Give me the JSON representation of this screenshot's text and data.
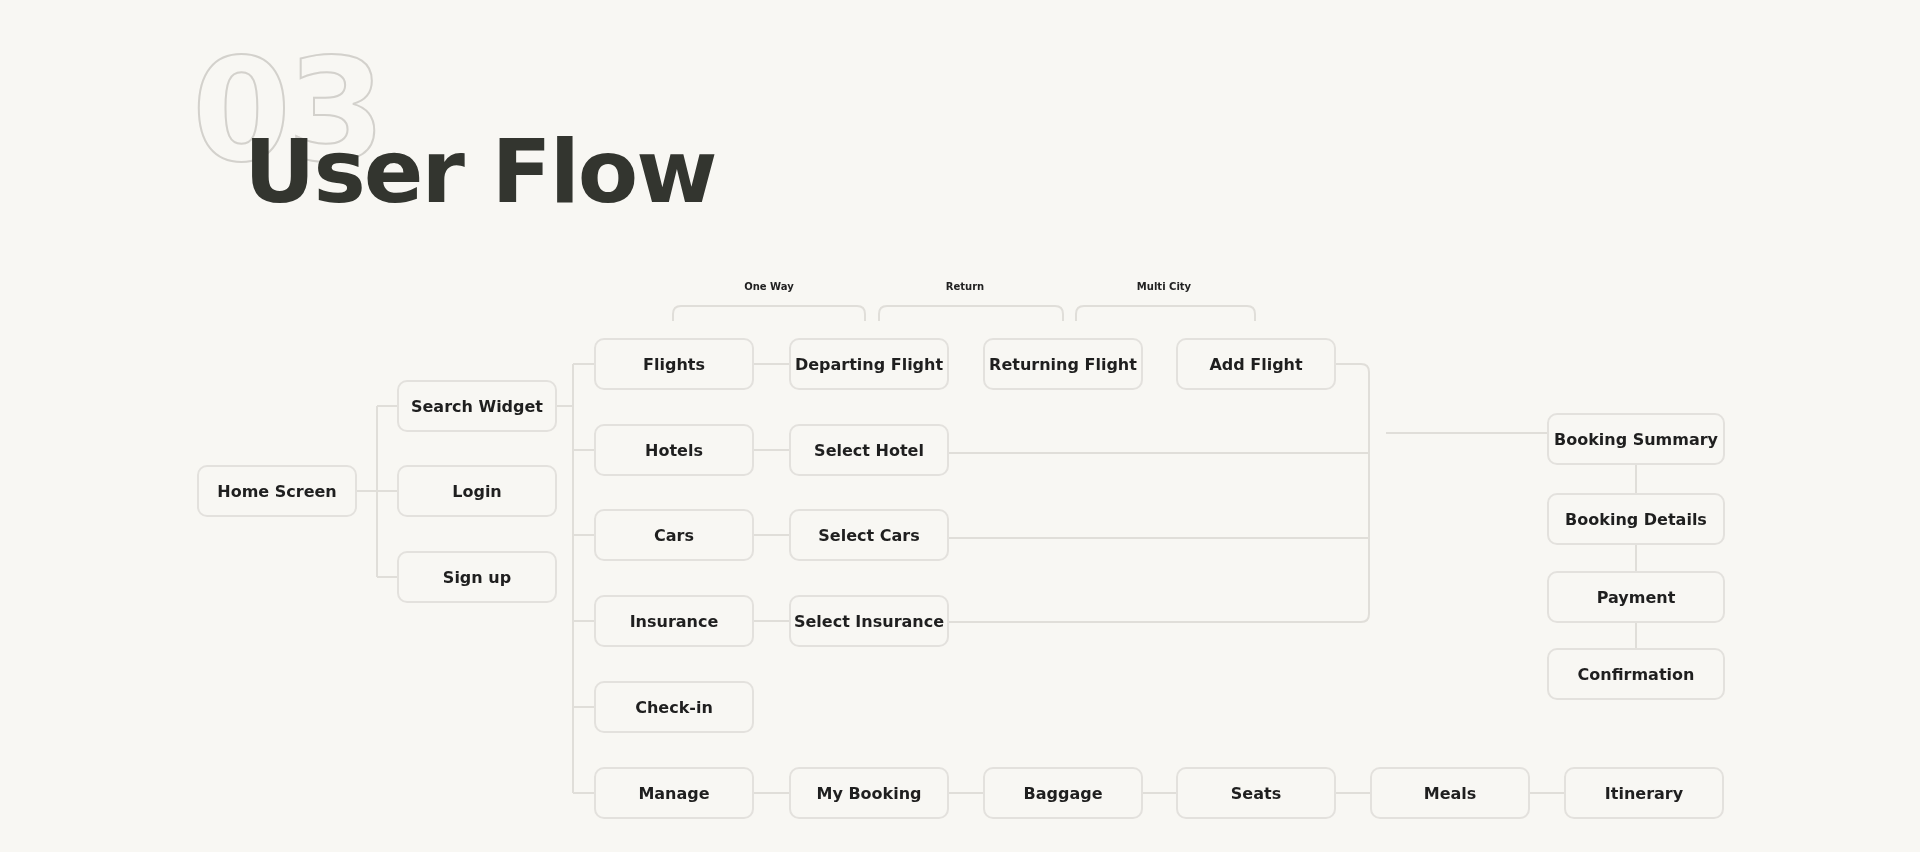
{
  "heading": {
    "number": "03",
    "title": "User Flow"
  },
  "trip_types": [
    {
      "label": "One Way"
    },
    {
      "label": "Return"
    },
    {
      "label": "Multi City"
    }
  ],
  "home": {
    "label": "Home Screen"
  },
  "entry": [
    {
      "label": "Search Widget"
    },
    {
      "label": "Login"
    },
    {
      "label": "Sign up"
    }
  ],
  "products": [
    {
      "label": "Flights"
    },
    {
      "label": "Hotels"
    },
    {
      "label": "Cars"
    },
    {
      "label": "Insurance"
    },
    {
      "label": "Check-in"
    },
    {
      "label": "Manage"
    }
  ],
  "selections": [
    {
      "label": "Departing Flight"
    },
    {
      "label": "Select Hotel"
    },
    {
      "label": "Select Cars"
    },
    {
      "label": "Select Insurance"
    }
  ],
  "flight_steps": [
    {
      "label": "Returning Flight"
    },
    {
      "label": "Add Flight"
    }
  ],
  "manage_steps": [
    {
      "label": "My Booking"
    },
    {
      "label": "Baggage"
    },
    {
      "label": "Seats"
    },
    {
      "label": "Meals"
    },
    {
      "label": "Itinerary"
    }
  ],
  "booking_steps": [
    {
      "label": "Booking Summary"
    },
    {
      "label": "Booking Details"
    },
    {
      "label": "Payment"
    },
    {
      "label": "Confirmation"
    }
  ]
}
